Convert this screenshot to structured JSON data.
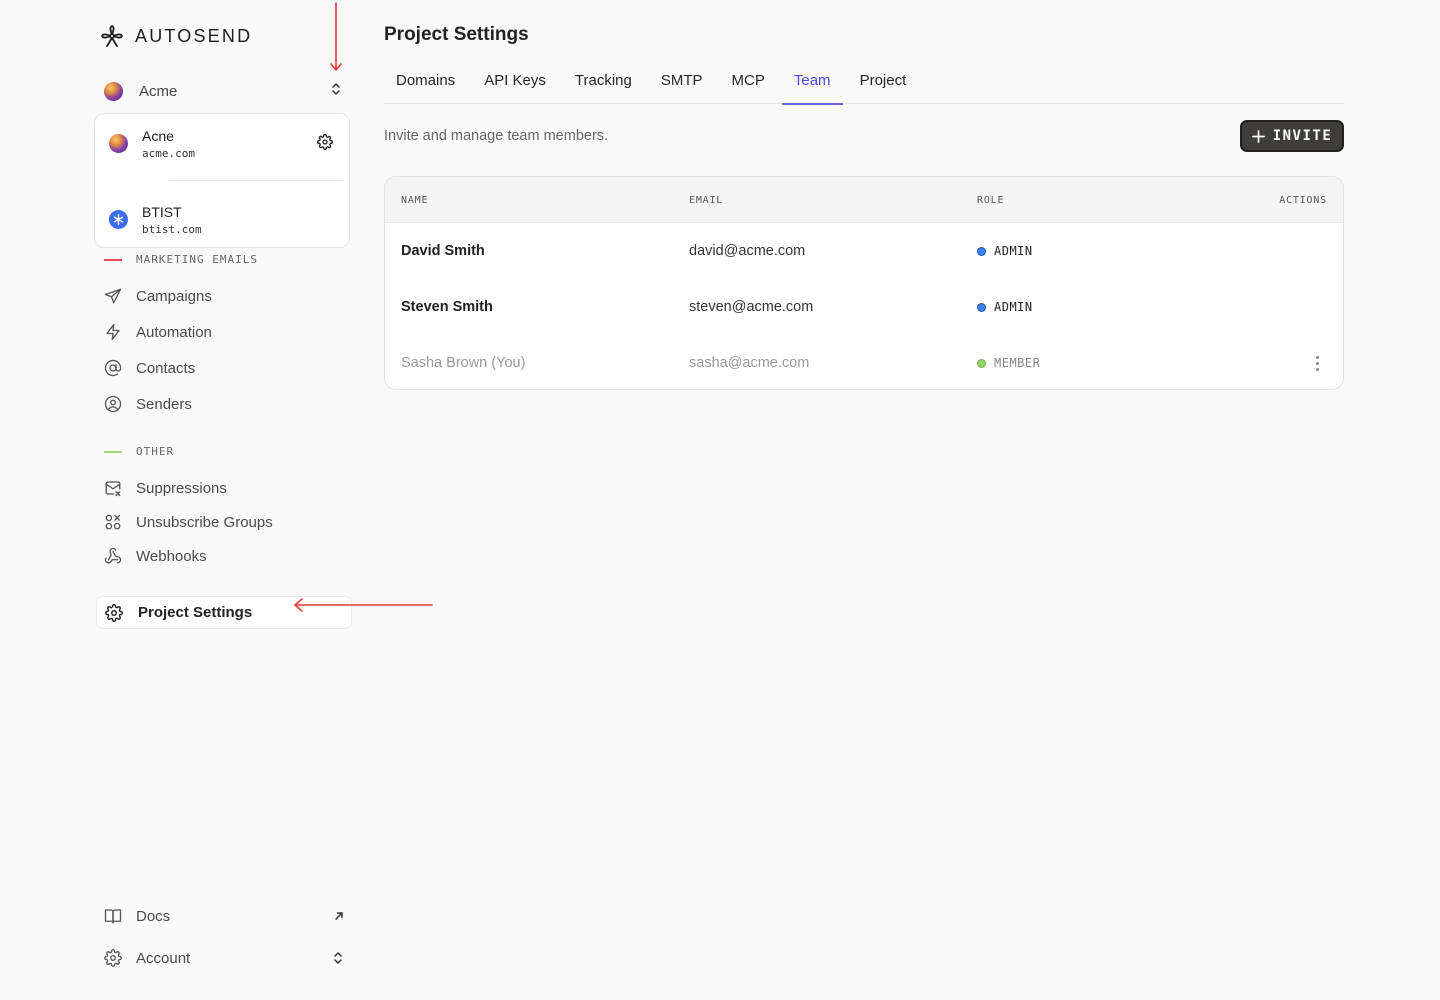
{
  "app": {
    "brand": "AUTOSEND"
  },
  "workspace": {
    "current": "Acme",
    "options": [
      {
        "name": "Acne",
        "domain": "acme.com"
      },
      {
        "name": "BTIST",
        "domain": "btist.com"
      }
    ]
  },
  "sidebar": {
    "sections": [
      {
        "label": "MARKETING EMAILS",
        "accent": "#e5484d",
        "items": [
          {
            "label": "Campaigns",
            "icon": "send-icon"
          },
          {
            "label": "Automation",
            "icon": "lightning-icon"
          },
          {
            "label": "Contacts",
            "icon": "at-sign-icon"
          },
          {
            "label": "Senders",
            "icon": "user-circle-icon"
          }
        ]
      },
      {
        "label": "OTHER",
        "accent": "#a3d977",
        "items": [
          {
            "label": "Suppressions",
            "icon": "mail-x-icon"
          },
          {
            "label": "Unsubscribe Groups",
            "icon": "groups-icon"
          },
          {
            "label": "Webhooks",
            "icon": "webhook-icon"
          }
        ]
      }
    ],
    "active_item": {
      "label": "Project Settings",
      "icon": "gear-icon"
    },
    "bottom": [
      {
        "label": "Docs",
        "icon": "book-icon",
        "trailing_icon": "external-arrow-icon"
      },
      {
        "label": "Account",
        "icon": "gear-icon",
        "trailing_icon": "chevron-updown-icon"
      }
    ]
  },
  "main": {
    "title": "Project Settings",
    "tabs": [
      {
        "label": "Domains"
      },
      {
        "label": "API Keys"
      },
      {
        "label": "Tracking"
      },
      {
        "label": "SMTP"
      },
      {
        "label": "MCP"
      },
      {
        "label": "Team",
        "active": true
      },
      {
        "label": "Project"
      }
    ],
    "subtitle": "Invite and manage team members.",
    "invite_button": "INVITE",
    "table": {
      "columns": [
        "NAME",
        "EMAIL",
        "ROLE",
        "ACTIONS"
      ],
      "rows": [
        {
          "name": "David Smith",
          "email": "david@acme.com",
          "role": "ADMIN",
          "role_color": "#3b82f6"
        },
        {
          "name": "Steven Smith",
          "email": "steven@acme.com",
          "role": "ADMIN",
          "role_color": "#3b82f6"
        },
        {
          "name": "Sasha Brown (You)",
          "email": "sasha@acme.com",
          "role": "MEMBER",
          "role_color": "#8fd466"
        }
      ]
    }
  },
  "colors": {
    "accent": "#4f46e5",
    "annotation": "#e53935"
  }
}
